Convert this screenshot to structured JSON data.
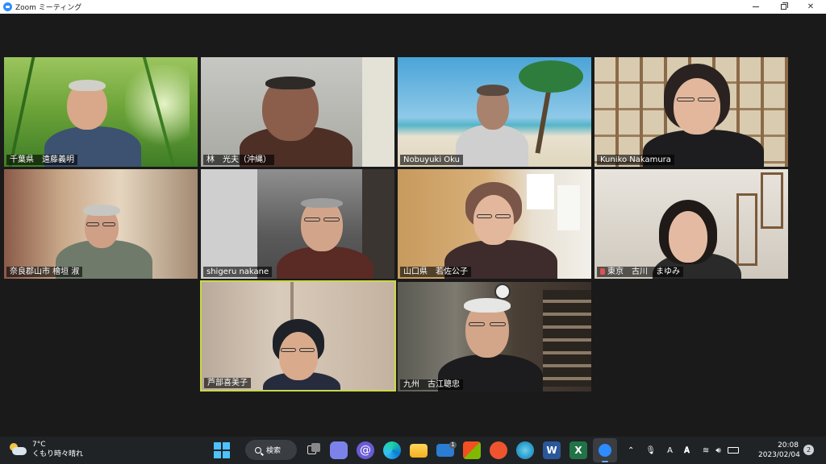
{
  "window": {
    "title": "Zoom ミーティング"
  },
  "participants": [
    {
      "name": "千葉県　遠藤義明"
    },
    {
      "name": "林　光夫（沖縄）"
    },
    {
      "name": "Nobuyuki Oku"
    },
    {
      "name": "Kuniko Nakamura"
    },
    {
      "name": "奈良郡山市 檜垣 淑"
    },
    {
      "name": "shigeru nakane"
    },
    {
      "name": "山口県　若佐公子"
    },
    {
      "name": "東京　古川　まゆみ",
      "muted": true
    },
    {
      "name": "芦部喜美子",
      "active_speaker": true
    },
    {
      "name": "九州　古江聰忠"
    }
  ],
  "taskbar": {
    "weather_temp": "7°C",
    "weather_desc": "くもり時々晴れ",
    "search_label": "検索",
    "mail_badge": "1",
    "time": "20:08",
    "date": "2023/02/04",
    "notification_count": "2",
    "ime_label": "A"
  },
  "colors": {
    "accent_active_speaker": "#c9d94a",
    "zoom_blue": "#2d8cff",
    "taskbar_bg": "#202326"
  }
}
